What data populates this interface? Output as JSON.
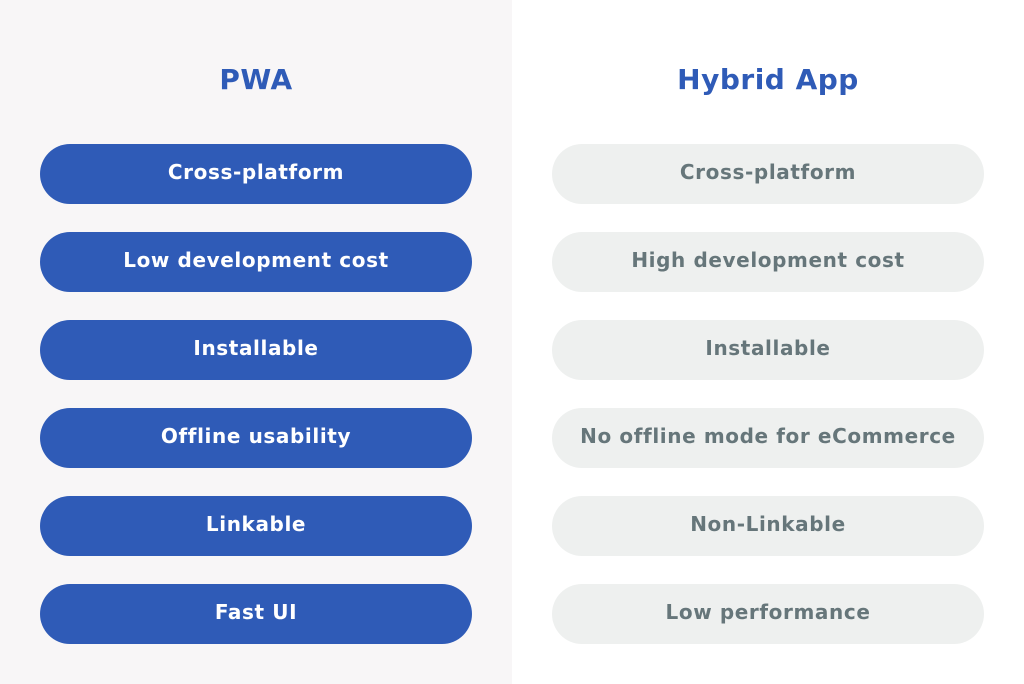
{
  "colors": {
    "accent": "#2f5bb7",
    "muted_text": "#66767a",
    "muted_pill": "#eef0ef",
    "left_bg": "#f8f6f7"
  },
  "pwa": {
    "title": "PWA",
    "items": [
      "Cross-platform",
      "Low development cost",
      "Installable",
      "Offline usability",
      "Linkable",
      "Fast UI"
    ]
  },
  "hybrid": {
    "title": "Hybrid App",
    "items": [
      "Cross-platform",
      "High development cost",
      "Installable",
      "No offline mode for eCommerce",
      "Non-Linkable",
      "Low performance"
    ]
  }
}
